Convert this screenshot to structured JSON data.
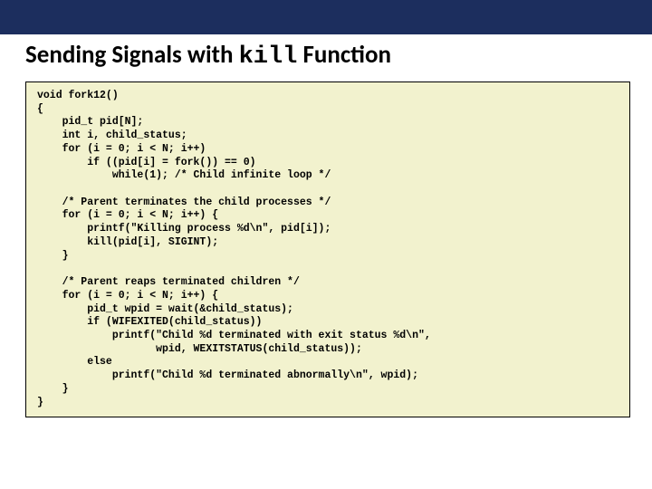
{
  "title": {
    "prefix": "Sending Signals with ",
    "mono": "kill",
    "suffix": " Function"
  },
  "code": "void fork12()\n{\n    pid_t pid[N];\n    int i, child_status;\n    for (i = 0; i < N; i++)\n        if ((pid[i] = fork()) == 0)\n            while(1); /* Child infinite loop */\n\n    /* Parent terminates the child processes */\n    for (i = 0; i < N; i++) {\n        printf(\"Killing process %d\\n\", pid[i]);\n        kill(pid[i], SIGINT);\n    }\n\n    /* Parent reaps terminated children */\n    for (i = 0; i < N; i++) {\n        pid_t wpid = wait(&child_status);\n        if (WIFEXITED(child_status))\n            printf(\"Child %d terminated with exit status %d\\n\",\n                   wpid, WEXITSTATUS(child_status));\n        else\n            printf(\"Child %d terminated abnormally\\n\", wpid);\n    }\n}"
}
